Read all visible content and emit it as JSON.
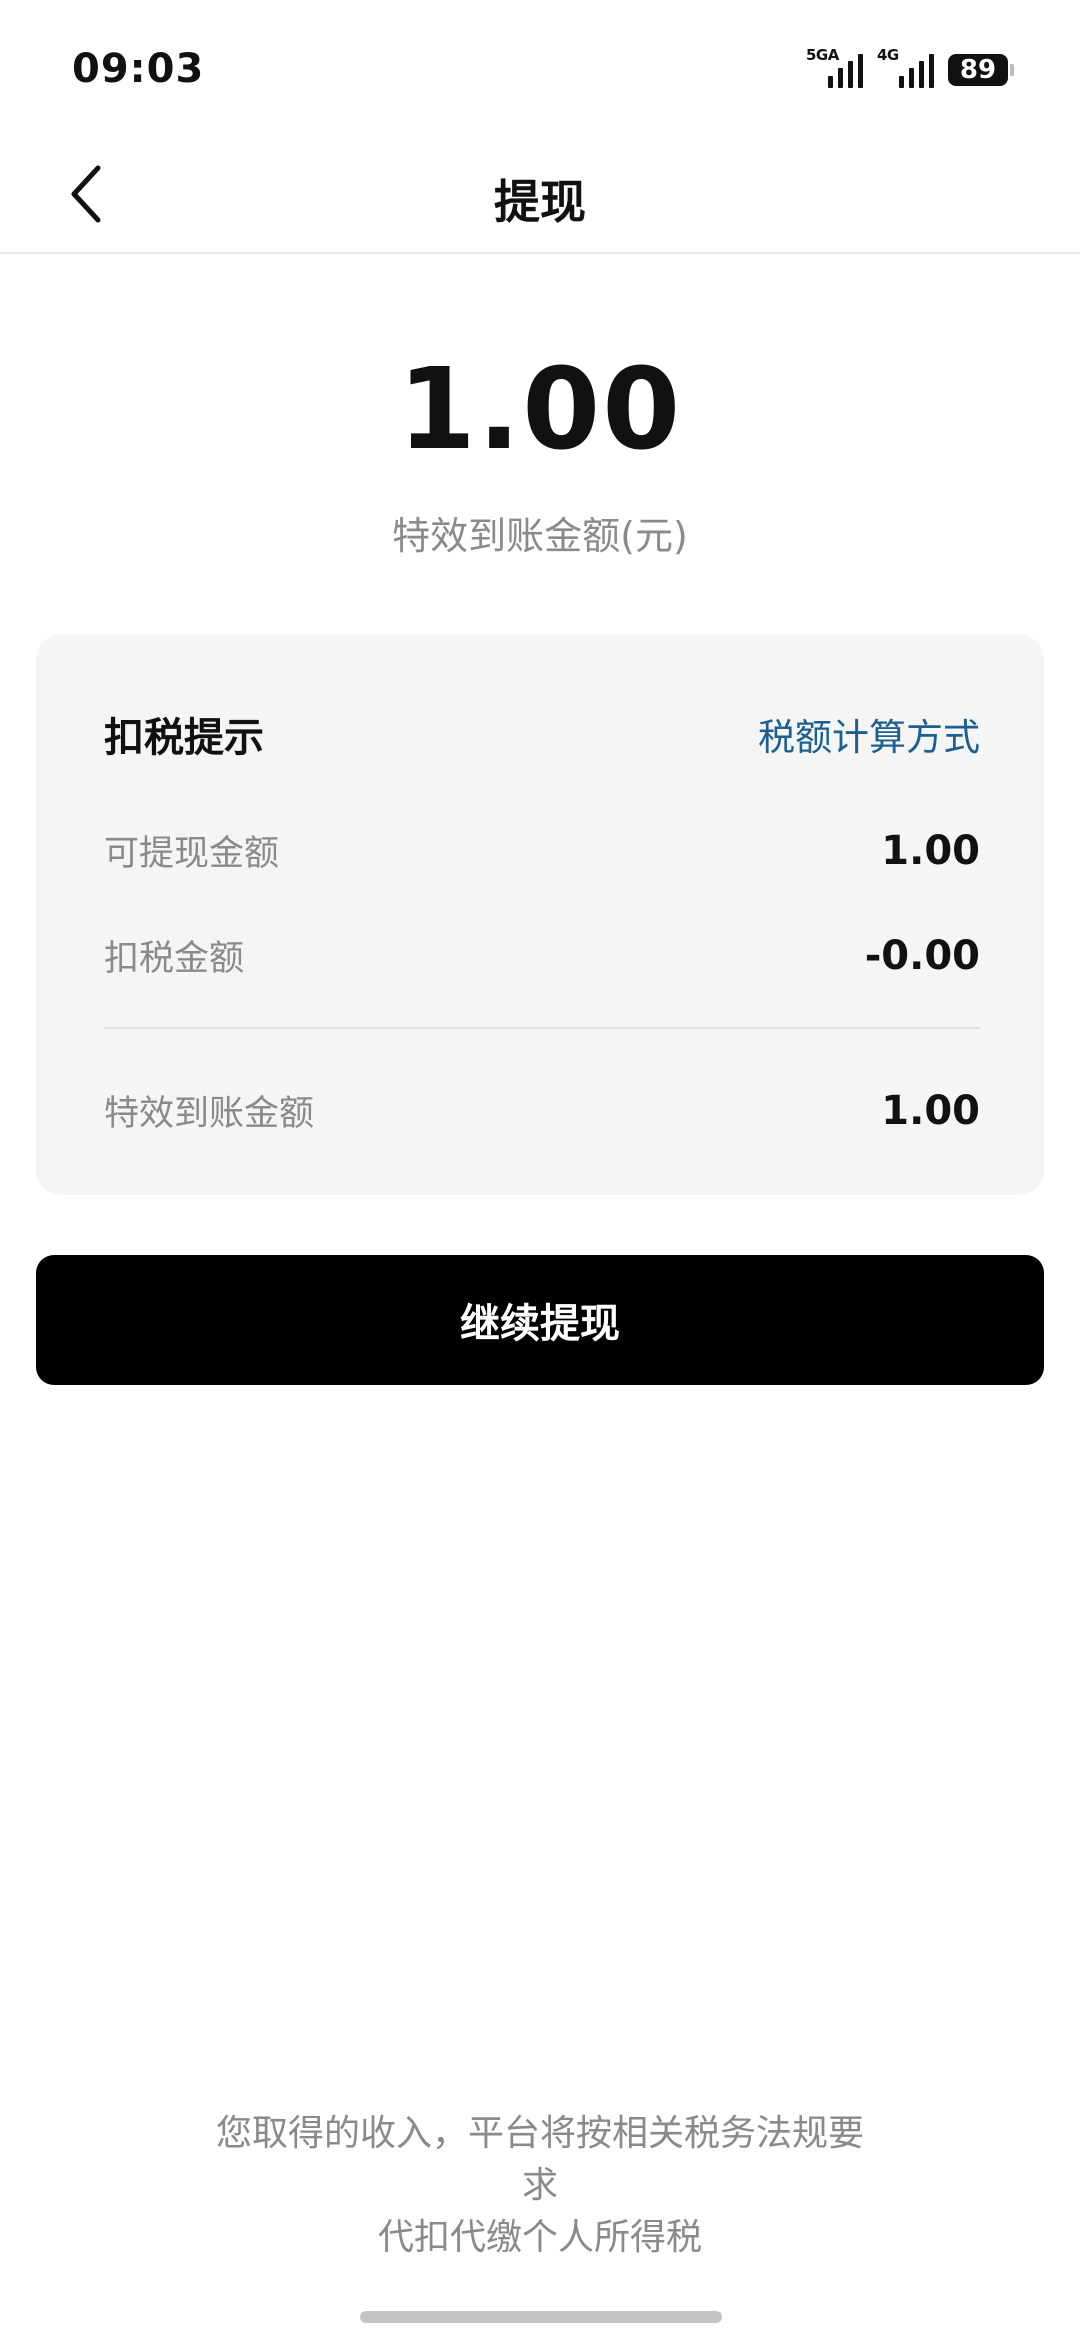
{
  "status_bar": {
    "time": "09:03",
    "signal_1_label": "5GA",
    "signal_2_label": "4G",
    "battery": "89"
  },
  "nav": {
    "title": "提现"
  },
  "amount": {
    "value": "1.00",
    "label": "特效到账金额(元)"
  },
  "tax_card": {
    "title": "扣税提示",
    "calc_link": "税额计算方式",
    "rows": [
      {
        "label": "可提现金额",
        "value": "1.00"
      },
      {
        "label": "扣税金额",
        "value": "-0.00"
      },
      {
        "label": "特效到账金额",
        "value": "1.00"
      }
    ]
  },
  "continue_button": "继续提现",
  "footer_note": {
    "line1": "您取得的收入，平台将按相关税务法规要",
    "line2": "求",
    "line3": "代扣代缴个人所得税"
  },
  "icons": {
    "back": "chevron-left-icon",
    "signal": "signal-strength-icon",
    "battery": "battery-icon"
  },
  "colors": {
    "link": "#1f5f8f",
    "button_bg": "#000000",
    "card_bg": "#f5f5f5",
    "muted_text": "#8a8a8a"
  }
}
